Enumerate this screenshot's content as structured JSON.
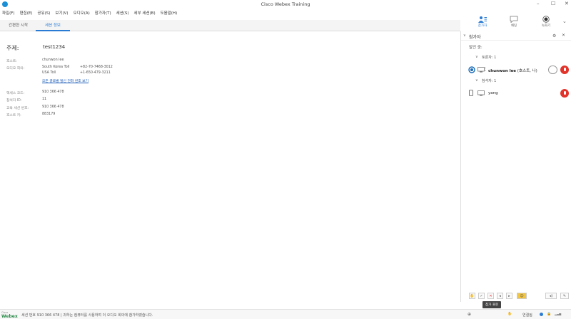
{
  "window": {
    "title": "Cisco Webex Training"
  },
  "menu": [
    "파일(F)",
    "편집(E)",
    "공유(S)",
    "보기(V)",
    "오디오(A)",
    "참가자(T)",
    "세션(S)",
    "세부 세션(B)",
    "도움말(H)"
  ],
  "tabs": {
    "quick_start": "간편한 시작",
    "session_info": "세션 정보"
  },
  "session": {
    "subject_label": "주제:",
    "subject_value": "test1234",
    "host_label": "호스트:",
    "host_value": "chunwon lee",
    "audio_label": "오디오 회의:",
    "audio_rows": [
      {
        "name": "South Korea Toll",
        "number": "+82-70-7468-3012"
      },
      {
        "name": "USA Toll",
        "number": "+1-650-479-3211"
      }
    ],
    "global_link": "모든 글로벌 발신 전화 번호 보기",
    "access_code_label": "액세스 코드:",
    "access_code_value": "910 366 478",
    "attendee_id_label": "참석자 ID:",
    "attendee_id_value": "11",
    "session_number_label": "교육 세션 번호:",
    "session_number_value": "910 366 478",
    "host_key_label": "호스트 키:",
    "host_key_value": "883179"
  },
  "sidebar": {
    "participants_btn": "참가자",
    "chat_btn": "채팅",
    "record_btn": "녹화기"
  },
  "panel": {
    "header": "참가자",
    "speaking": "발언 중:",
    "panelists_group": "토론자: 1",
    "attendees_group": "참석자: 1",
    "panelist_name": "chunwon lee",
    "panelist_suffix": "(호스트, 나)",
    "attendee_name": "yang"
  },
  "tooltip": "참가 표현",
  "status": {
    "logo_small": "Cisco",
    "logo": "Webex",
    "text": "세션 번호 910 366 478  |  귀하는 컴퓨터를 사용하여 이 오디오 회의에 참가하였습니다.",
    "connected": "연결됨"
  },
  "colors": {
    "accent": "#2a7bd3",
    "mic_red": "#e2342a",
    "link": "#1a5bb8"
  }
}
